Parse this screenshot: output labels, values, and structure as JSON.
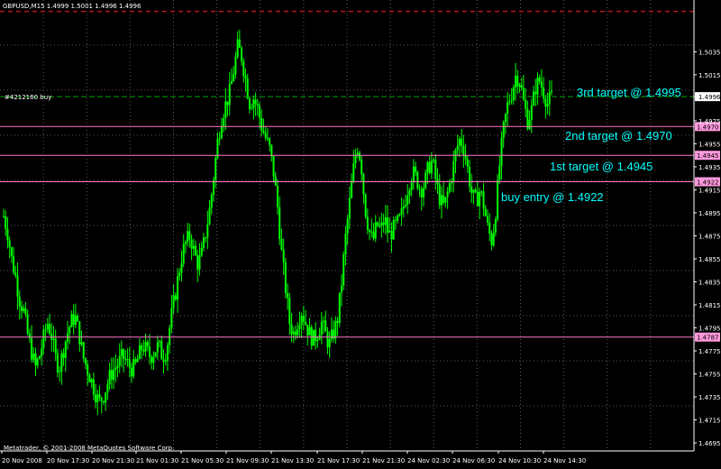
{
  "symbol_header": "GBPUSD,M15  1.4999 1.5001 1.4996 1.4996",
  "order_label": "#4212160 buy",
  "copyright": "Metatrader, © 2001-2008 MetaQuotes Software Corp.",
  "annotations": {
    "third": "3rd target @ 1.4995",
    "second": "2nd target @ 1.4970",
    "first": "1st target @ 1.4945",
    "entry": "buy entry @ 1.4922"
  },
  "colors": {
    "background": "#000000",
    "grid": "#5a5a5a",
    "candles": "#00ff00",
    "level_lines": "#ff77cc",
    "stop_line": "#ff2020",
    "order_line": "#00aa00",
    "annotation_text": "#00ffff"
  },
  "chart_data": {
    "type": "candlestick",
    "symbol": "GBPUSD",
    "timeframe": "M15",
    "current_price": "1.4996",
    "y_ticks": [
      "1.5035",
      "1.5015",
      "1.4996",
      "1.4975",
      "1.4955",
      "1.4935",
      "1.4915",
      "1.4895",
      "1.4875",
      "1.4855",
      "1.4835",
      "1.4815",
      "1.4795",
      "1.4775",
      "1.4755",
      "1.4735",
      "1.4715",
      "1.4695"
    ],
    "x_ticks": [
      "20 Nov 2008",
      "20 Nov 17:30",
      "20 Nov 21:30",
      "21 Nov 01:30",
      "21 Nov 05:30",
      "21 Nov 09:30",
      "21 Nov 13:30",
      "21 Nov 17:30",
      "21 Nov 21:30",
      "24 Nov 02:30",
      "24 Nov 06:30",
      "24 Nov 10:30",
      "24 Nov 14:30"
    ],
    "levels": [
      {
        "price": "1.4970",
        "label": "1.4970"
      },
      {
        "price": "1.4945",
        "label": "1.4945"
      },
      {
        "price": "1.4922",
        "label": "1.4922"
      },
      {
        "price": "1.4787",
        "label": "1.4787"
      }
    ],
    "stop_level": "1.5070",
    "order_price": "1.4996",
    "price_path": [
      1.4892,
      1.4878,
      1.4855,
      1.484,
      1.482,
      1.481,
      1.479,
      1.4775,
      1.476,
      1.477,
      1.4785,
      1.48,
      1.479,
      1.477,
      1.476,
      1.4775,
      1.479,
      1.48,
      1.4805,
      1.479,
      1.477,
      1.476,
      1.475,
      1.474,
      1.473,
      1.4735,
      1.4745,
      1.4755,
      1.476,
      1.4765,
      1.477,
      1.4765,
      1.476,
      1.476,
      1.477,
      1.478,
      1.4775,
      1.477,
      1.4775,
      1.478,
      1.477,
      1.4775,
      1.48,
      1.482,
      1.484,
      1.486,
      1.487,
      1.4875,
      1.486,
      1.485,
      1.486,
      1.488,
      1.49,
      1.493,
      1.496,
      1.498,
      1.499,
      1.5,
      1.502,
      1.504,
      1.503,
      1.501,
      1.499,
      1.4995,
      1.4985,
      1.497,
      1.496,
      1.495,
      1.493,
      1.49,
      1.486,
      1.483,
      1.48,
      1.479,
      1.48,
      1.481,
      1.48,
      1.479,
      1.4785,
      1.479,
      1.48,
      1.479,
      1.478,
      1.479,
      1.48,
      1.483,
      1.487,
      1.49,
      1.493,
      1.4955,
      1.494,
      1.49,
      1.488,
      1.487,
      1.4885,
      1.488,
      1.489,
      1.4875,
      1.488,
      1.4885,
      1.489,
      1.4905,
      1.492,
      1.493,
      1.4925,
      1.4915,
      1.492,
      1.4935,
      1.494,
      1.492,
      1.4905,
      1.49,
      1.4915,
      1.493,
      1.495,
      1.496,
      1.495,
      1.493,
      1.491,
      1.4905,
      1.4915,
      1.49,
      1.488,
      1.487,
      1.49,
      1.494,
      1.497,
      1.499,
      1.5,
      1.5015,
      1.501,
      1.499,
      1.4975,
      1.4985,
      1.5005,
      1.501,
      1.5,
      1.499,
      1.4996
    ]
  }
}
